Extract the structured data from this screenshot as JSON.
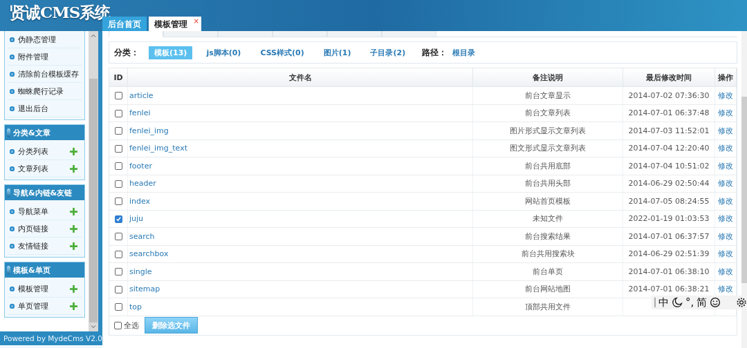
{
  "header": {
    "logo": "贤诚CMS系统",
    "tabs": [
      {
        "label": "后台首页",
        "selected": false
      },
      {
        "label": "模板管理",
        "selected": true,
        "close": "×"
      }
    ]
  },
  "sidebar": {
    "top_items": [
      "伪静态管理",
      "附件管理",
      "清除前台模板缓存",
      "蜘蛛爬行记录",
      "退出后台"
    ],
    "groups": [
      {
        "title": "分类&文章",
        "items": [
          "分类列表",
          "文章列表"
        ]
      },
      {
        "title": "导航&内链&友链",
        "items": [
          "导航菜单",
          "内页链接",
          "友情链接"
        ]
      },
      {
        "title": "模板&单页",
        "items": [
          "模板管理",
          "单页管理"
        ]
      }
    ],
    "footer": "Powered by MydeCms V2.0"
  },
  "sub_tabs": [
    {
      "selected": true
    },
    {
      "selected": false
    },
    {
      "selected": false
    },
    {
      "selected": false
    },
    {
      "selected": false
    },
    {
      "selected": false
    }
  ],
  "filter": {
    "label": "分类：",
    "categories": [
      {
        "label": "模板(13)",
        "selected": true
      },
      {
        "label": "js脚本(0)",
        "selected": false
      },
      {
        "label": "CSS样式(0)",
        "selected": false
      },
      {
        "label": "图片(1)",
        "selected": false
      },
      {
        "label": "子目录(2)",
        "selected": false
      }
    ],
    "path_label": "路径：",
    "path": "根目录"
  },
  "table": {
    "columns": [
      "ID",
      "文件名",
      "备注说明",
      "最后修改时间",
      "操作"
    ],
    "rows": [
      {
        "name": "article",
        "note": "前台文章显示",
        "time": "2014-07-02 07:36:30",
        "action": "修改",
        "checked": false
      },
      {
        "name": "fenlei",
        "note": "前台文章列表",
        "time": "2014-07-01 06:37:48",
        "action": "修改",
        "checked": false
      },
      {
        "name": "fenlei_img",
        "note": "图片形式显示文章列表",
        "time": "2014-07-03 11:52:01",
        "action": "修改",
        "checked": false
      },
      {
        "name": "fenlei_img_text",
        "note": "图文形式显示文章列表",
        "time": "2014-07-04 12:20:40",
        "action": "修改",
        "checked": false
      },
      {
        "name": "footer",
        "note": "前台共用底部",
        "time": "2014-07-04 10:51:02",
        "action": "修改",
        "checked": false
      },
      {
        "name": "header",
        "note": "前台共用头部",
        "time": "2014-06-29 02:50:44",
        "action": "修改",
        "checked": false
      },
      {
        "name": "index",
        "note": "网站首页模板",
        "time": "2014-07-05 08:24:55",
        "action": "修改",
        "checked": false
      },
      {
        "name": "juju",
        "note": "未知文件",
        "time": "2022-01-19 01:03:53",
        "action": "修改",
        "checked": true
      },
      {
        "name": "search",
        "note": "前台搜索结果",
        "time": "2014-07-01 06:37:57",
        "action": "修改",
        "checked": false
      },
      {
        "name": "searchbox",
        "note": "前台共用搜索块",
        "time": "2014-06-29 02:51:39",
        "action": "修改",
        "checked": false
      },
      {
        "name": "single",
        "note": "前台单页",
        "time": "2014-07-01 06:38:10",
        "action": "修改",
        "checked": false
      },
      {
        "name": "sitemap",
        "note": "前台网站地图",
        "time": "2014-07-01 06:38:21",
        "action": "修改",
        "checked": false
      },
      {
        "name": "top",
        "note": "顶部共用文件",
        "checked": false
      }
    ],
    "select_all": {
      "label": "全选",
      "checked": false
    },
    "delete_button": "删除选文件"
  },
  "ime_bar": {
    "mode": "中",
    "punct": "°,",
    "script": "简"
  }
}
